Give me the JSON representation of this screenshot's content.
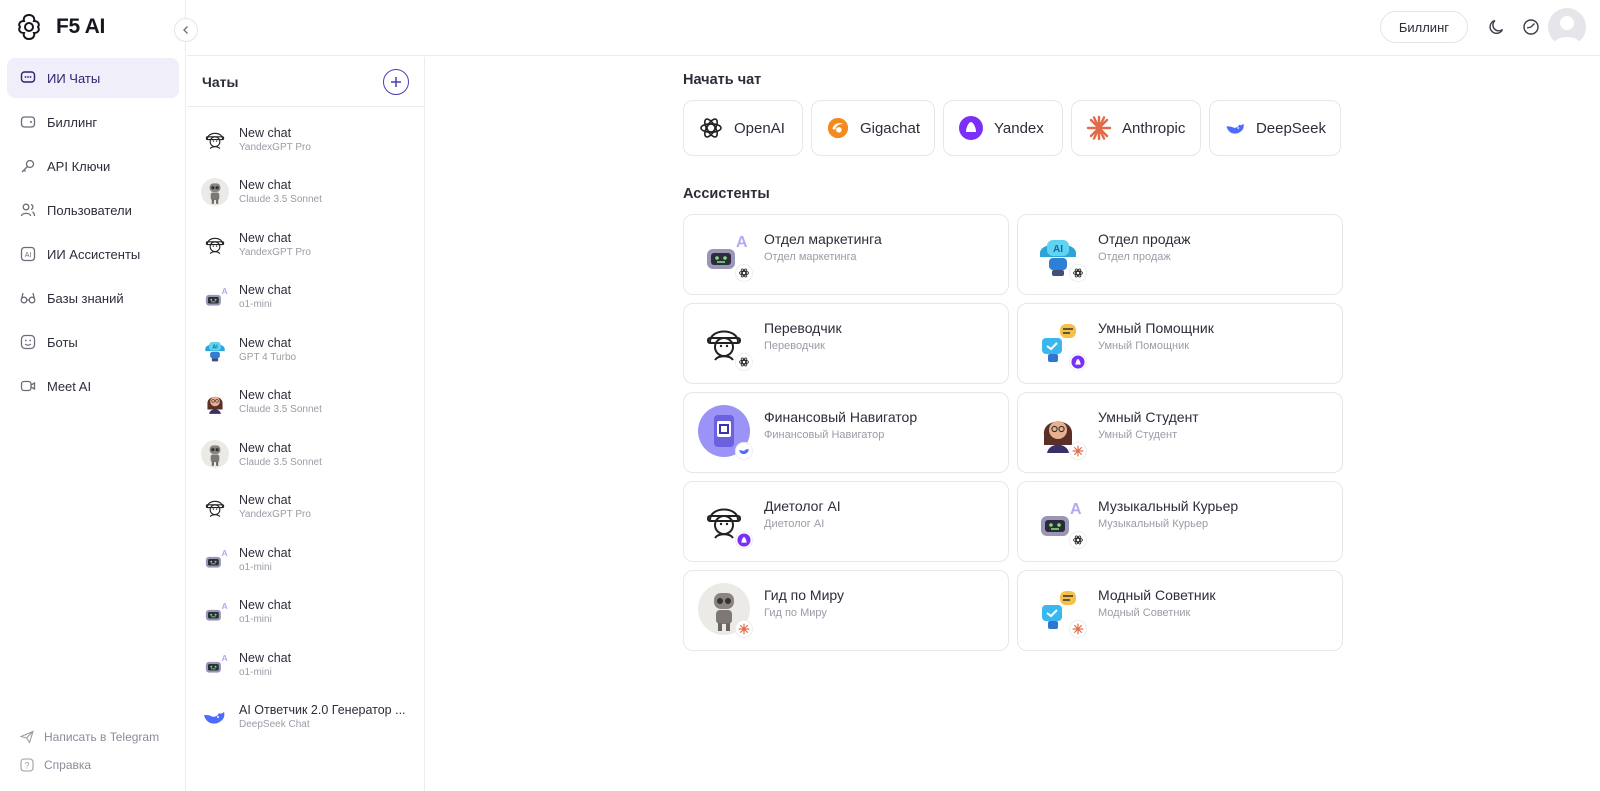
{
  "app": {
    "name": "F5 AI"
  },
  "sidebar": {
    "items": [
      {
        "label": "ИИ Чаты",
        "icon": "chat-icon",
        "active": true
      },
      {
        "label": "Биллинг",
        "icon": "wallet-icon"
      },
      {
        "label": "API Ключи",
        "icon": "key-icon"
      },
      {
        "label": "Пользователи",
        "icon": "users-icon"
      },
      {
        "label": "ИИ Ассистенты",
        "icon": "ai-icon"
      },
      {
        "label": "Базы знаний",
        "icon": "glasses-icon"
      },
      {
        "label": "Боты",
        "icon": "bot-icon"
      },
      {
        "label": "Meet AI",
        "icon": "video-icon"
      }
    ],
    "bottom": [
      {
        "label": "Написать в Telegram",
        "icon": "send-icon"
      },
      {
        "label": "Справка",
        "icon": "help-icon"
      }
    ]
  },
  "header": {
    "billing_label": "Биллинг"
  },
  "chats": {
    "title": "Чаты",
    "items": [
      {
        "title": "New chat",
        "model": "YandexGPT Pro",
        "avatar": "sketch"
      },
      {
        "title": "New chat",
        "model": "Claude 3.5 Sonnet",
        "avatar": "robot-gray"
      },
      {
        "title": "New chat",
        "model": "YandexGPT Pro",
        "avatar": "sketch"
      },
      {
        "title": "New chat",
        "model": "o1-mini",
        "avatar": "robot-purple"
      },
      {
        "title": "New chat",
        "model": "GPT 4 Turbo",
        "avatar": "robot-blue"
      },
      {
        "title": "New chat",
        "model": "Claude 3.5 Sonnet",
        "avatar": "girl"
      },
      {
        "title": "New chat",
        "model": "Claude 3.5 Sonnet",
        "avatar": "robot-gray"
      },
      {
        "title": "New chat",
        "model": "YandexGPT Pro",
        "avatar": "sketch"
      },
      {
        "title": "New chat",
        "model": "o1-mini",
        "avatar": "robot-purple"
      },
      {
        "title": "New chat",
        "model": "o1-mini",
        "avatar": "robot-purple"
      },
      {
        "title": "New chat",
        "model": "o1-mini",
        "avatar": "robot-purple"
      },
      {
        "title": "AI Ответчик 2.0 Генератор ...",
        "model": "DeepSeek Chat",
        "avatar": "deepseek"
      }
    ]
  },
  "main": {
    "start_title": "Начать чат",
    "models": [
      {
        "label": "OpenAI",
        "icon": "openai-icon",
        "color": "#222222"
      },
      {
        "label": "Gigachat",
        "icon": "gigachat-icon",
        "color": "#f07a1a"
      },
      {
        "label": "Yandex",
        "icon": "yandex-icon",
        "color": "#7b2ff7"
      },
      {
        "label": "Anthropic",
        "icon": "anthropic-icon",
        "color": "#e06a4a"
      },
      {
        "label": "DeepSeek",
        "icon": "deepseek-icon",
        "color": "#4d6bfe"
      }
    ],
    "assistants_title": "Ассистенты",
    "assistants": [
      {
        "name": "Отдел маркетинга",
        "sub": "Отдел маркетинга",
        "avatar": "robot-purple",
        "badge": "openai"
      },
      {
        "name": "Отдел продаж",
        "sub": "Отдел продаж",
        "avatar": "robot-blue",
        "badge": "openai"
      },
      {
        "name": "Переводчик",
        "sub": "Переводчик",
        "avatar": "sketch",
        "badge": "openai"
      },
      {
        "name": "Умный Помощник",
        "sub": "Умный Помощник",
        "avatar": "helper",
        "badge": "yandex"
      },
      {
        "name": "Финансовый Навигатор",
        "sub": "Финансовый Навигатор",
        "avatar": "finance",
        "badge": "deepseek"
      },
      {
        "name": "Умный Студент",
        "sub": "Умный Студент",
        "avatar": "girl",
        "badge": "anthropic"
      },
      {
        "name": "Диетолог AI",
        "sub": "Диетолог AI",
        "avatar": "sketch",
        "badge": "yandex"
      },
      {
        "name": "Музыкальный Курьер",
        "sub": "Музыкальный Курьер",
        "avatar": "robot-purple",
        "badge": "openai"
      },
      {
        "name": "Гид по Миру",
        "sub": "Гид по Миру",
        "avatar": "robot-gray",
        "badge": "anthropic"
      },
      {
        "name": "Модный Советник",
        "sub": "Модный Советник",
        "avatar": "helper",
        "badge": "anthropic"
      }
    ]
  }
}
